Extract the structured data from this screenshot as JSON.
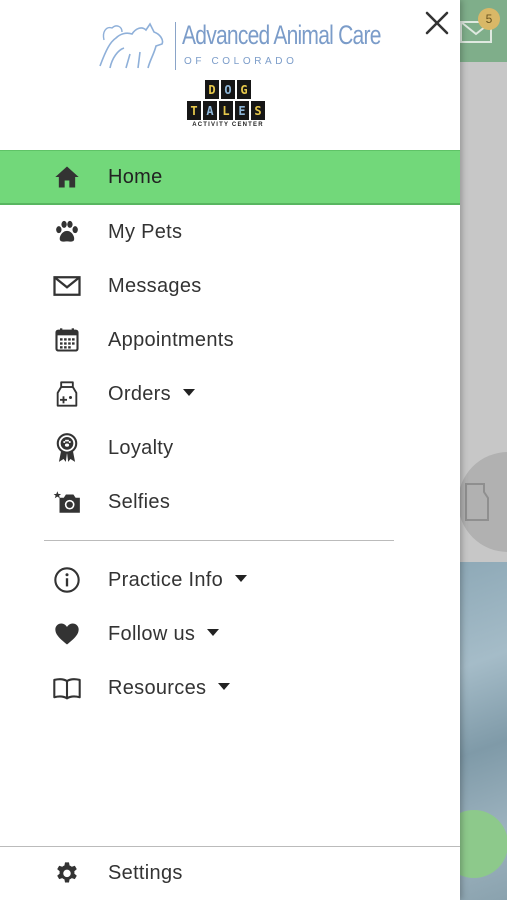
{
  "background": {
    "message_badge": "5",
    "header_color": "#7fae8a",
    "fab_color": "#8dc98b"
  },
  "drawer": {
    "close_icon": "close-icon",
    "logo": {
      "title": "Advanced Animal Care",
      "subtitle": "OF COLORADO",
      "sub_logo_row1": [
        "D",
        "O",
        "G"
      ],
      "sub_logo_row2": [
        "T",
        "A",
        "L",
        "E",
        "S"
      ],
      "sub_logo_caption": "ACTIVITY CENTER"
    },
    "accent_color": "#72d87a",
    "items": [
      {
        "label": "Home",
        "icon": "home-icon",
        "active": true
      },
      {
        "label": "My Pets",
        "icon": "paw-icon"
      },
      {
        "label": "Messages",
        "icon": "envelope-icon"
      },
      {
        "label": "Appointments",
        "icon": "calendar-icon"
      },
      {
        "label": "Orders",
        "icon": "medicine-bag-icon",
        "has_dropdown": true
      },
      {
        "label": "Loyalty",
        "icon": "award-ribbon-icon"
      },
      {
        "label": "Selfies",
        "icon": "camera-icon"
      }
    ],
    "secondary_items": [
      {
        "label": "Practice Info",
        "icon": "info-icon",
        "has_dropdown": true
      },
      {
        "label": "Follow us",
        "icon": "heart-icon",
        "has_dropdown": true
      },
      {
        "label": "Resources",
        "icon": "book-icon",
        "has_dropdown": true
      }
    ],
    "footer": {
      "label": "Settings",
      "icon": "gear-icon"
    }
  }
}
